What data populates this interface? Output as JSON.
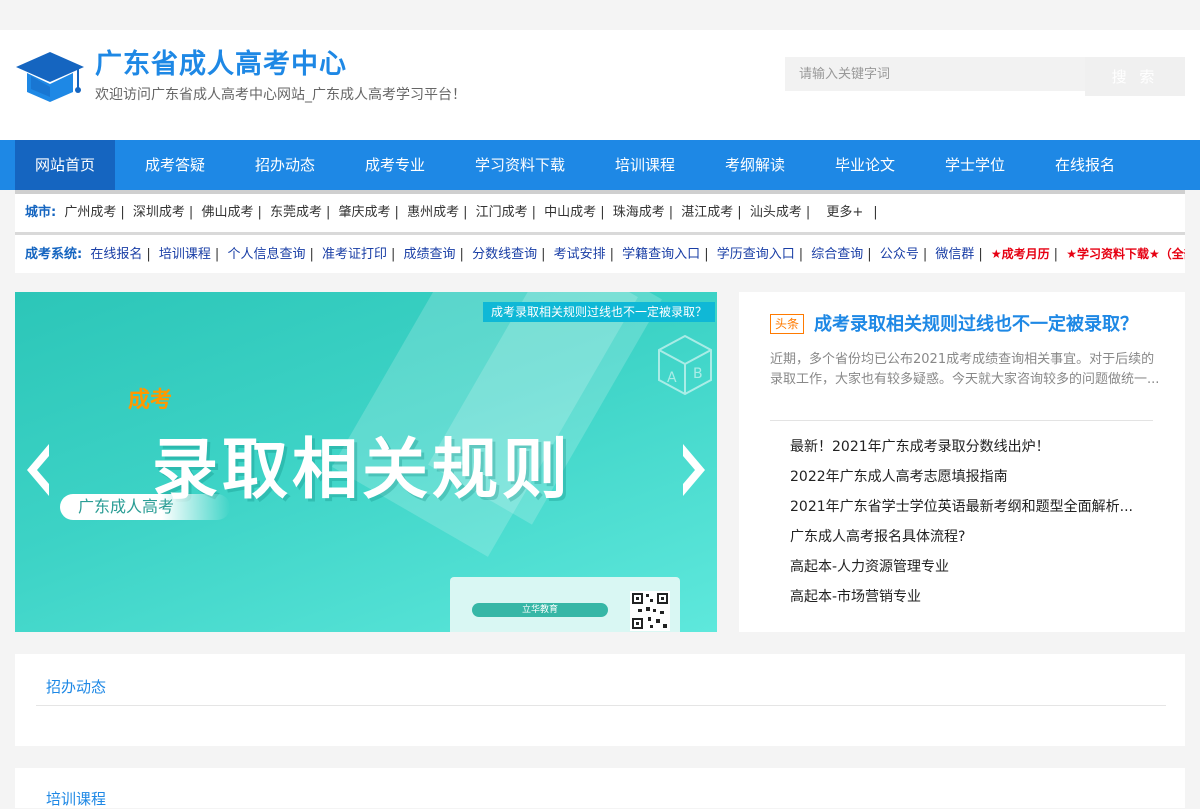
{
  "header": {
    "site_title": "广东省成人高考中心",
    "site_subtitle": "欢迎访问广东省成人高考中心网站_广东成人高考学习平台！",
    "search_placeholder": "请输入关键字词",
    "search_button": "搜 索"
  },
  "nav": {
    "items": [
      "网站首页",
      "成考答疑",
      "招办动态",
      "成考专业",
      "学习资料下载",
      "培训课程",
      "考纲解读",
      "毕业论文",
      "学士学位",
      "在线报名"
    ],
    "active_index": 0
  },
  "city_row": {
    "label": "城市:",
    "cities": [
      "广州成考",
      "深圳成考",
      "佛山成考",
      "东莞成考",
      "肇庆成考",
      "惠州成考",
      "江门成考",
      "中山成考",
      "珠海成考",
      "湛江成考",
      "汕头成考"
    ],
    "more": "更多+"
  },
  "system_row": {
    "label": "成考系统:",
    "links": [
      "在线报名",
      "培训课程",
      "个人信息查询",
      "准考证打印",
      "成绩查询",
      "分数线查询",
      "考试安排",
      "学籍查询入口",
      "学历查询入口",
      "综合查询",
      "公众号",
      "微信群"
    ],
    "highlight_links": [
      "★成考月历",
      "★学习资料下载★（全部免"
    ]
  },
  "banner": {
    "tag": "成考录取相关规则过线也不一定被录取？",
    "small_text": "成考",
    "big_text": "录取相关规则",
    "pill_text": "广东成人高考",
    "card_label": "立华教育",
    "cube_letters": [
      "A",
      "B"
    ]
  },
  "headline": {
    "badge": "头条",
    "title": "成考录取相关规则过线也不一定被录取？",
    "summary": "近期，多个省份均已公布2021成考成绩查询相关事宜。对于后续的录取工作，大家也有较多疑惑。今天就大家咨询较多的问题做统一..."
  },
  "news": [
    "最新！2021年广东成考录取分数线出炉！",
    "2022年广东成人高考志愿填报指南",
    "2021年广东省学士学位英语最新考纲和题型全面解析...",
    "广东成人高考报名具体流程?",
    "高起本-人力资源管理专业",
    "高起本-市场营销专业"
  ],
  "sections": [
    "招办动态",
    "培训课程"
  ],
  "colors": {
    "primary": "#1e88e5",
    "nav_active": "#1565c0",
    "badge": "#ff7a00",
    "system_link": "#1a3fa6",
    "highlight_red": "#e60012",
    "banner_teal": "#3dd3c6"
  }
}
